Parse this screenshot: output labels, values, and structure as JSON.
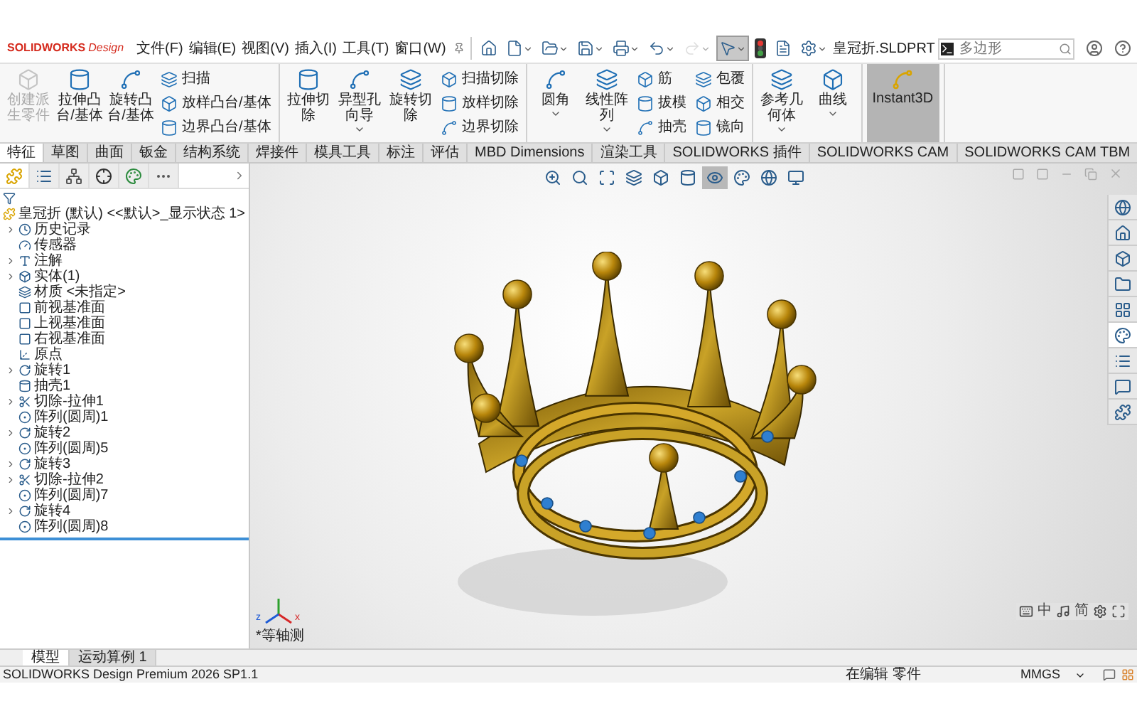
{
  "app": {
    "brand": "SOLIDWORKS",
    "edition": "Design"
  },
  "menu": [
    "文件(F)",
    "编辑(E)",
    "视图(V)",
    "插入(I)",
    "工具(T)",
    "窗口(W)"
  ],
  "quick_access": [
    {
      "kind": "home",
      "selected": false,
      "disabled": false
    },
    {
      "kind": "new",
      "has_menu": true,
      "selected": false,
      "disabled": false
    },
    {
      "kind": "open",
      "has_menu": true,
      "selected": false,
      "disabled": false
    },
    {
      "kind": "save",
      "has_menu": true,
      "selected": false,
      "disabled": false
    },
    {
      "kind": "print",
      "has_menu": true,
      "selected": false,
      "disabled": false
    },
    {
      "kind": "undo",
      "has_menu": true,
      "selected": false,
      "disabled": false
    },
    {
      "kind": "redo",
      "has_menu": true,
      "selected": false,
      "disabled": true
    },
    {
      "kind": "select",
      "has_menu": true,
      "selected": true,
      "disabled": false
    },
    {
      "kind": "rebuild",
      "selected": false,
      "disabled": false
    },
    {
      "kind": "properties",
      "selected": false,
      "disabled": false
    },
    {
      "kind": "options",
      "has_menu": true,
      "selected": false,
      "disabled": false
    }
  ],
  "document_title": "皇冠折.SLDPRT",
  "search": {
    "placeholder": "多边形"
  },
  "ribbon": {
    "groups": [
      {
        "items": [
          {
            "kind": "large",
            "label": "创建派生零件",
            "disabled": true
          },
          {
            "kind": "large",
            "label": "拉伸凸台/基体",
            "disabled": false
          },
          {
            "kind": "large",
            "label": "旋转凸台/基体",
            "disabled": false
          },
          {
            "kind": "small",
            "label": "扫描",
            "disabled": false
          },
          {
            "kind": "small",
            "label": "放样凸台/基体",
            "disabled": false
          },
          {
            "kind": "small",
            "label": "边界凸台/基体",
            "disabled": false
          }
        ]
      },
      {
        "items": [
          {
            "kind": "large",
            "label": "拉伸切除",
            "disabled": false
          },
          {
            "kind": "large",
            "label": "异型孔向导",
            "disabled": false,
            "has_menu": true
          },
          {
            "kind": "large",
            "label": "旋转切除",
            "disabled": false
          },
          {
            "kind": "small",
            "label": "扫描切除",
            "disabled": false
          },
          {
            "kind": "small",
            "label": "放样切除",
            "disabled": false
          },
          {
            "kind": "small",
            "label": "边界切除",
            "disabled": false
          }
        ]
      },
      {
        "items": [
          {
            "kind": "large",
            "label": "圆角",
            "disabled": false,
            "has_menu": true
          },
          {
            "kind": "large",
            "label": "线性阵列",
            "disabled": false,
            "has_menu": true
          },
          {
            "kind": "small",
            "label": "筋",
            "disabled": false
          },
          {
            "kind": "small",
            "label": "拔模",
            "disabled": false
          },
          {
            "kind": "small",
            "label": "抽壳",
            "disabled": false
          },
          {
            "kind": "small",
            "label": "包覆",
            "disabled": false
          },
          {
            "kind": "small",
            "label": "相交",
            "disabled": false
          },
          {
            "kind": "small",
            "label": "镜向",
            "disabled": false
          }
        ]
      },
      {
        "items": [
          {
            "kind": "large",
            "label": "参考几何体",
            "disabled": false,
            "has_menu": true
          },
          {
            "kind": "large",
            "label": "曲线",
            "disabled": false,
            "has_menu": true
          }
        ]
      },
      {
        "items": [
          {
            "kind": "toggle",
            "label": "Instant3D",
            "disabled": false,
            "selected": true
          }
        ]
      }
    ]
  },
  "tabs": [
    {
      "label": "特征",
      "selected": true
    },
    {
      "label": "草图",
      "selected": false
    },
    {
      "label": "曲面",
      "selected": false
    },
    {
      "label": "钣金",
      "selected": false
    },
    {
      "label": "结构系统",
      "selected": false
    },
    {
      "label": "焊接件",
      "selected": false
    },
    {
      "label": "模具工具",
      "selected": false
    },
    {
      "label": "标注",
      "selected": false
    },
    {
      "label": "评估",
      "selected": false
    },
    {
      "label": "MBD Dimensions",
      "selected": false
    },
    {
      "label": "渲染工具",
      "selected": false
    },
    {
      "label": "SOLIDWORKS 插件",
      "selected": false
    },
    {
      "label": "SOLIDWORKS CAM",
      "selected": false
    },
    {
      "label": "SOLIDWORKS CAM TBM",
      "selected": false
    }
  ],
  "feature_manager": {
    "panel_tabs": [
      {
        "selected": true
      },
      {
        "selected": false
      },
      {
        "selected": false
      },
      {
        "selected": false
      },
      {
        "selected": false
      },
      {
        "selected": false
      }
    ],
    "root": "皇冠折 (默认) <<默认>_显示状态 1>",
    "items": [
      {
        "kind": "history",
        "label": "历史记录",
        "expandable": true
      },
      {
        "kind": "sensor",
        "label": "传感器",
        "expandable": false
      },
      {
        "kind": "annotation",
        "label": "注解",
        "expandable": true
      },
      {
        "kind": "solid",
        "label": "实体(1)",
        "expandable": true
      },
      {
        "kind": "material",
        "label": "材质 <未指定>",
        "expandable": false
      },
      {
        "kind": "plane",
        "label": "前视基准面",
        "expandable": false
      },
      {
        "kind": "plane",
        "label": "上视基准面",
        "expandable": false
      },
      {
        "kind": "plane",
        "label": "右视基准面",
        "expandable": false
      },
      {
        "kind": "origin",
        "label": "原点",
        "expandable": false
      },
      {
        "kind": "revolve",
        "label": "旋转1",
        "expandable": true
      },
      {
        "kind": "shell",
        "label": "抽壳1",
        "expandable": false
      },
      {
        "kind": "cut",
        "label": "切除-拉伸1",
        "expandable": true
      },
      {
        "kind": "pattern",
        "label": "阵列(圆周)1",
        "expandable": false
      },
      {
        "kind": "revolve",
        "label": "旋转2",
        "expandable": true
      },
      {
        "kind": "pattern",
        "label": "阵列(圆周)5",
        "expandable": false
      },
      {
        "kind": "revolve",
        "label": "旋转3",
        "expandable": true
      },
      {
        "kind": "cut",
        "label": "切除-拉伸2",
        "expandable": true
      },
      {
        "kind": "pattern",
        "label": "阵列(圆周)7",
        "expandable": false
      },
      {
        "kind": "revolve",
        "label": "旋转4",
        "expandable": true
      },
      {
        "kind": "pattern",
        "label": "阵列(圆周)8",
        "expandable": false
      }
    ]
  },
  "viewport": {
    "view_tools": [
      {
        "selected": false
      },
      {
        "selected": false
      },
      {
        "selected": false
      },
      {
        "selected": false
      },
      {
        "selected": false
      },
      {
        "selected": false
      },
      {
        "selected": true
      },
      {
        "selected": false
      },
      {
        "selected": false
      },
      {
        "selected": false
      }
    ],
    "task_pane": [
      {
        "selected": false
      },
      {
        "selected": false
      },
      {
        "selected": false
      },
      {
        "selected": false
      },
      {
        "selected": false
      },
      {
        "selected": true
      },
      {
        "selected": false
      },
      {
        "selected": false
      },
      {
        "selected": false
      }
    ],
    "triad": {
      "x_label": "x",
      "z_label": "z"
    },
    "view_name": "*等轴测",
    "ime": {
      "mode": "中",
      "script": "简"
    }
  },
  "bottom_tabs": [
    {
      "label": "模型",
      "selected": true
    },
    {
      "label": "运动算例 1",
      "selected": false
    }
  ],
  "status_bar": {
    "product": "SOLIDWORKS Design Premium 2026 SP1.1",
    "mode": "在编辑 零件",
    "units": "MMGS"
  }
}
